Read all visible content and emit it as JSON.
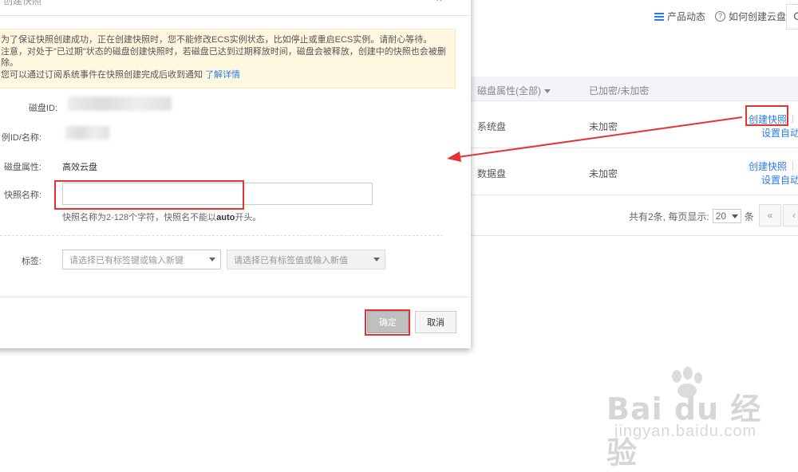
{
  "topbar": {
    "product_news": "产品动态",
    "how_to": "如何创建云盘"
  },
  "table": {
    "headers": {
      "disk_attr": "磁盘属性(全部)",
      "encrypted": "已加密/未加密"
    },
    "rows": [
      {
        "disk_attr": "系统盘",
        "encrypted": "未加密",
        "op_create": "创建快照",
        "op_set": "设置自动快"
      },
      {
        "disk_attr": "数据盘",
        "encrypted": "未加密",
        "op_create": "创建快照",
        "op_set": "设置自动快"
      }
    ]
  },
  "pager": {
    "summary": "共有2条, 每页显示:",
    "page_size": "20",
    "unit": "条",
    "prev": "«",
    "next": "‹"
  },
  "dialog": {
    "title": "创建快照",
    "close": "×",
    "notice_lines": [
      "为了保证快照创建成功，正在创建快照时，您不能修改ECS实例状态，比如停止或重启ECS实例。请耐心等待。",
      "注意，对处于\"已过期\"状态的磁盘创建快照时，若磁盘已达到过期释放时间，磁盘会被释放，创建中的快照也会被删",
      "除。",
      "您可以通过订阅系统事件在快照创建完成后收到通知"
    ],
    "notice_link": "了解详情",
    "fields": {
      "disk_id_label": "磁盘ID:",
      "instance_label": "例ID/名称:",
      "disk_attr_label": "磁盘属性:",
      "disk_attr_value": "高效云盘",
      "snapshot_name_label": "快照名称:",
      "snapshot_name_value": "",
      "hint_prefix": "快照名称为2-128个字符，快照名不能以",
      "hint_bold": "auto",
      "hint_suffix": "开头。",
      "tag_label": "标签:",
      "tag_key_placeholder": "请选择已有标签键或输入新键",
      "tag_value_placeholder": "请选择已有标签值或输入新值"
    },
    "buttons": {
      "ok": "确定",
      "cancel": "取消"
    }
  },
  "watermark": {
    "brand": "Bai du 经验",
    "url": "jingyan.baidu.com"
  },
  "annotation_color": "#e53333",
  "accent_color": "#2b7ce9"
}
